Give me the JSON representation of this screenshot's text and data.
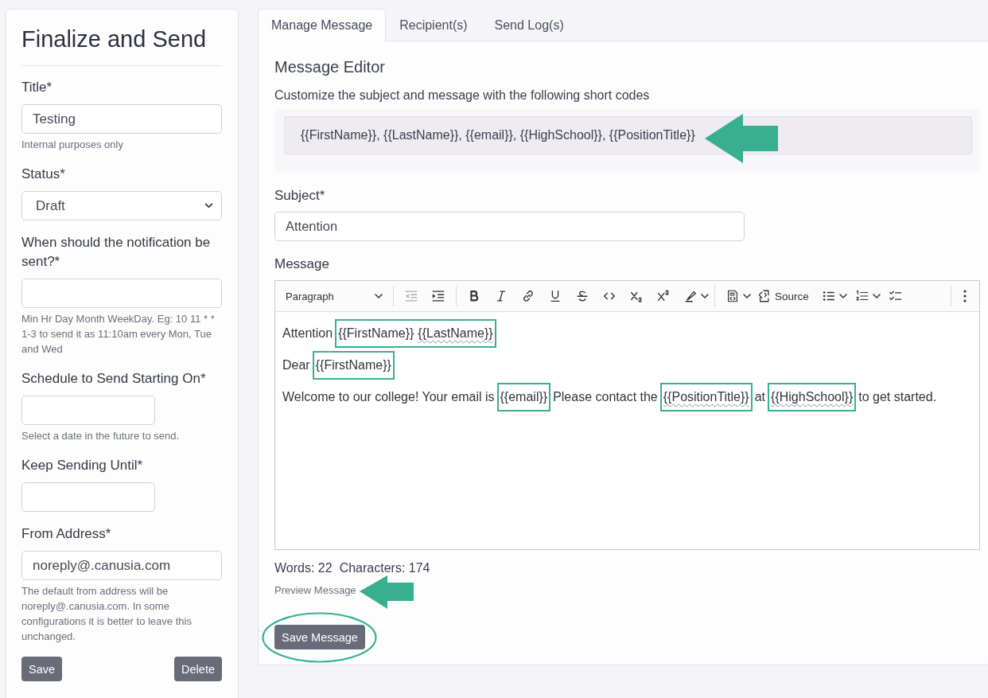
{
  "sidebar": {
    "title": "Finalize and Send",
    "fields": [
      {
        "kind": "text",
        "label": "Title*",
        "value": "Testing",
        "help": "Internal purposes only"
      },
      {
        "kind": "select",
        "label": "Status*",
        "value": "Draft"
      },
      {
        "kind": "text",
        "label": "When should the notification be sent?*",
        "help": "Min Hr Day Month WeekDay. Eg: 10 11 * * 1-3 to send it as 11:10am every Mon, Tue and Wed"
      },
      {
        "kind": "date",
        "label": "Schedule to Send Starting On*",
        "help": "Select a date in the future to send."
      },
      {
        "kind": "date",
        "label": "Keep Sending Until*"
      },
      {
        "kind": "text",
        "label": "From Address*",
        "value": "noreply@.canusia.com",
        "help": "The default from address will be noreply@.canusia.com. In some configurations it is better to leave this unchanged."
      }
    ],
    "buttons": [
      "Save",
      "Delete"
    ]
  },
  "tabs": [
    {
      "label": "Manage Message",
      "selected": true
    },
    {
      "label": "Recipient(s)",
      "selected": false
    },
    {
      "label": "Send Log(s)",
      "selected": false
    }
  ],
  "editor": {
    "heading": "Message Editor",
    "intro": "Customize the subject and message with the following short codes",
    "short_codes": {
      "text": "{{FirstName}}, {{LastName}}, {{email}}, {{HighSchool}}, {{PositionTitle}}",
      "arrow": true
    },
    "subject": {
      "label": "Subject*",
      "value": "Attention"
    },
    "message": {
      "label": "Message",
      "toolbar": {
        "block_format": "Paragraph",
        "source_label": "Source",
        "outdent_disabled": true
      },
      "paragraphs": [
        [
          {
            "highlighted": false,
            "runs": [
              {
                "text": "Attention",
                "misspelled": false
              }
            ]
          },
          {
            "highlighted": true,
            "runs": [
              {
                "text": "{{FirstName}}",
                "misspelled": false
              },
              {
                "text": "{{LastName}}",
                "misspelled": true
              }
            ]
          }
        ],
        [
          {
            "highlighted": false,
            "runs": [
              {
                "text": "Dear",
                "misspelled": false
              }
            ]
          },
          {
            "highlighted": true,
            "runs": [
              {
                "text": "{{FirstName}}",
                "misspelled": false
              }
            ]
          }
        ],
        [
          {
            "highlighted": false,
            "runs": [
              {
                "text": "Welcome to our college! Your email is",
                "misspelled": false
              }
            ]
          },
          {
            "highlighted": true,
            "runs": [
              {
                "text": "{{email}}",
                "misspelled": false
              }
            ]
          },
          {
            "highlighted": false,
            "runs": [
              {
                "text": "Please contact the",
                "misspelled": false
              }
            ]
          },
          {
            "highlighted": true,
            "runs": [
              {
                "text": "{{PositionTitle}}",
                "misspelled": true
              }
            ]
          },
          {
            "highlighted": false,
            "runs": [
              {
                "text": "at",
                "misspelled": false
              }
            ]
          },
          {
            "highlighted": true,
            "runs": [
              {
                "text": "{{HighSchool}}",
                "misspelled": true
              }
            ]
          },
          {
            "highlighted": false,
            "runs": [
              {
                "text": "to get started.",
                "misspelled": false
              }
            ]
          }
        ]
      ]
    },
    "word_count": "Words: 22",
    "character_count": "Characters: 174",
    "preview_link": {
      "label": "Preview Message",
      "arrow": true
    },
    "save_button": {
      "label": "Save Message",
      "circled": true
    }
  }
}
